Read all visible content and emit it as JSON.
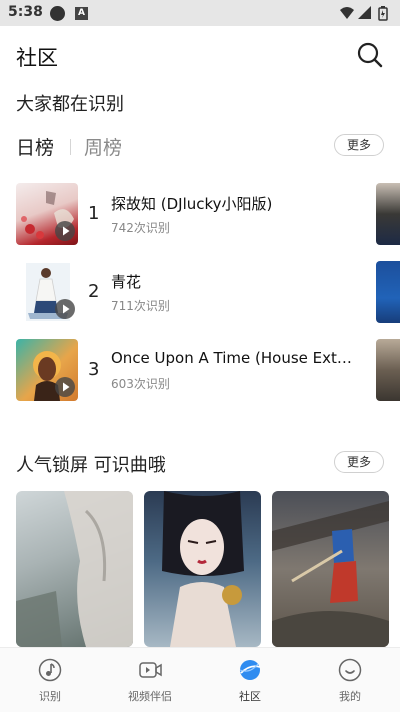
{
  "status_bar": {
    "time": "5:38",
    "notification_badge": "A"
  },
  "header": {
    "title": "社区",
    "search_icon": "search-icon"
  },
  "trending": {
    "title": "大家都在识别",
    "tabs": [
      {
        "label": "日榜",
        "active": true
      },
      {
        "label": "周榜",
        "active": false
      }
    ],
    "more_label": "更多",
    "items": [
      {
        "rank": "1",
        "title": "探故知 (DJlucky小阳版)",
        "count": "742次识别"
      },
      {
        "rank": "2",
        "title": "青花",
        "count": "711次识别"
      },
      {
        "rank": "3",
        "title": "Once Upon A Time (House Extended Mix)",
        "count": "603次识别"
      }
    ]
  },
  "lockscreen": {
    "title": "人气锁屏 可识曲哦",
    "more_label": "更多"
  },
  "bottom_nav": [
    {
      "label": "识别",
      "icon": "music-note-icon"
    },
    {
      "label": "视频伴侣",
      "icon": "video-play-icon"
    },
    {
      "label": "社区",
      "icon": "planet-icon",
      "active": true
    },
    {
      "label": "我的",
      "icon": "smile-icon"
    }
  ],
  "colors": {
    "accent": "#2f8cf0",
    "text": "#222222",
    "secondary_text": "#888888",
    "status_bar": "#e6e6e6"
  }
}
